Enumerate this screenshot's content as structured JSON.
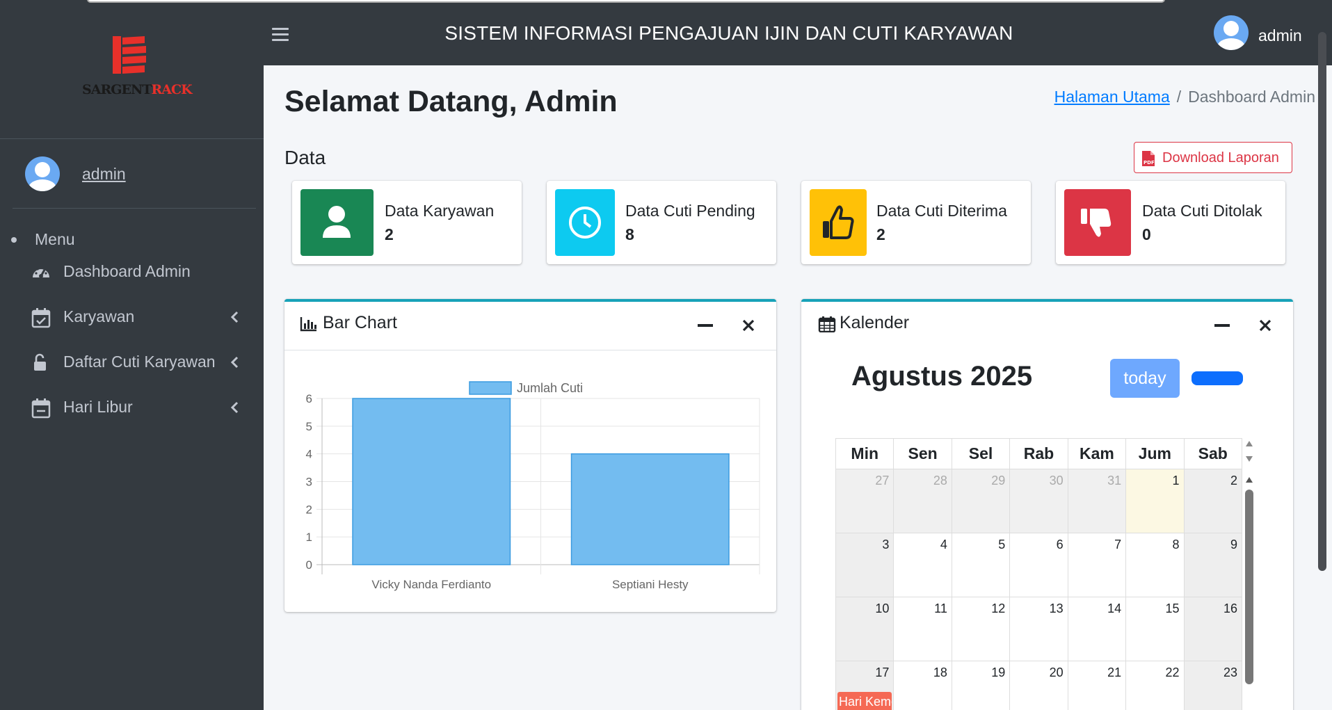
{
  "header": {
    "app_title": "SISTEM INFORMASI PENGAJUAN IJIN DAN CUTI KARYAWAN",
    "user_name": "admin"
  },
  "sidebar": {
    "logo": {
      "part1": "SARGENT",
      "part2": "RACK",
      "brand_color": "#e8302a"
    },
    "user_name": "admin",
    "menu_header": "Menu",
    "items": [
      {
        "label": "Dashboard Admin",
        "icon": "tachometer-icon"
      },
      {
        "label": "Karyawan",
        "icon": "calendar-check-icon"
      },
      {
        "label": "Daftar Cuti Karyawan",
        "icon": "unlock-icon"
      },
      {
        "label": "Hari Libur",
        "icon": "calendar-minus-icon"
      }
    ]
  },
  "page": {
    "title": "Selamat Datang, Admin",
    "breadcrumb": {
      "home": "Halaman Utama",
      "separator": "/",
      "current": "Dashboard Admin"
    },
    "section_title": "Data",
    "download_button": "Download Laporan"
  },
  "info_boxes": [
    {
      "label": "Data Karyawan",
      "value": "2",
      "color": "#198754",
      "icon": "user-icon"
    },
    {
      "label": "Data Cuti Pending",
      "value": "8",
      "color": "#0dcaf0",
      "icon": "clock-icon"
    },
    {
      "label": "Data Cuti Diterima",
      "value": "2",
      "color": "#ffc107",
      "icon": "thumbs-up-icon"
    },
    {
      "label": "Data Cuti Ditolak",
      "value": "0",
      "color": "#dc3545",
      "icon": "thumbs-down-icon"
    }
  ],
  "bar_card": {
    "title": "Bar Chart"
  },
  "chart_data": {
    "type": "bar",
    "categories": [
      "Vicky Nanda Ferdianto",
      "Septiani Hesty"
    ],
    "series": [
      {
        "name": "Jumlah Cuti",
        "values": [
          6,
          4
        ],
        "color": "#73bcf0"
      }
    ],
    "ylim": [
      0,
      6
    ],
    "yticks": [
      "0",
      "1",
      "2",
      "3",
      "4",
      "5",
      "6"
    ],
    "grid": true,
    "legend": "top"
  },
  "calendar_card": {
    "title": "Kalender",
    "month_title": "Agustus 2025",
    "today_button": "today",
    "weekdays": [
      "Min",
      "Sen",
      "Sel",
      "Rab",
      "Kam",
      "Jum",
      "Sab"
    ],
    "weeks": [
      [
        "27",
        "28",
        "29",
        "30",
        "31",
        "1",
        "2"
      ],
      [
        "3",
        "4",
        "5",
        "6",
        "7",
        "8",
        "9"
      ],
      [
        "10",
        "11",
        "12",
        "13",
        "14",
        "15",
        "16"
      ],
      [
        "17",
        "18",
        "19",
        "20",
        "21",
        "22",
        "23"
      ]
    ],
    "event": "Hari Kemerdekaan",
    "event_color": "#f56954"
  }
}
